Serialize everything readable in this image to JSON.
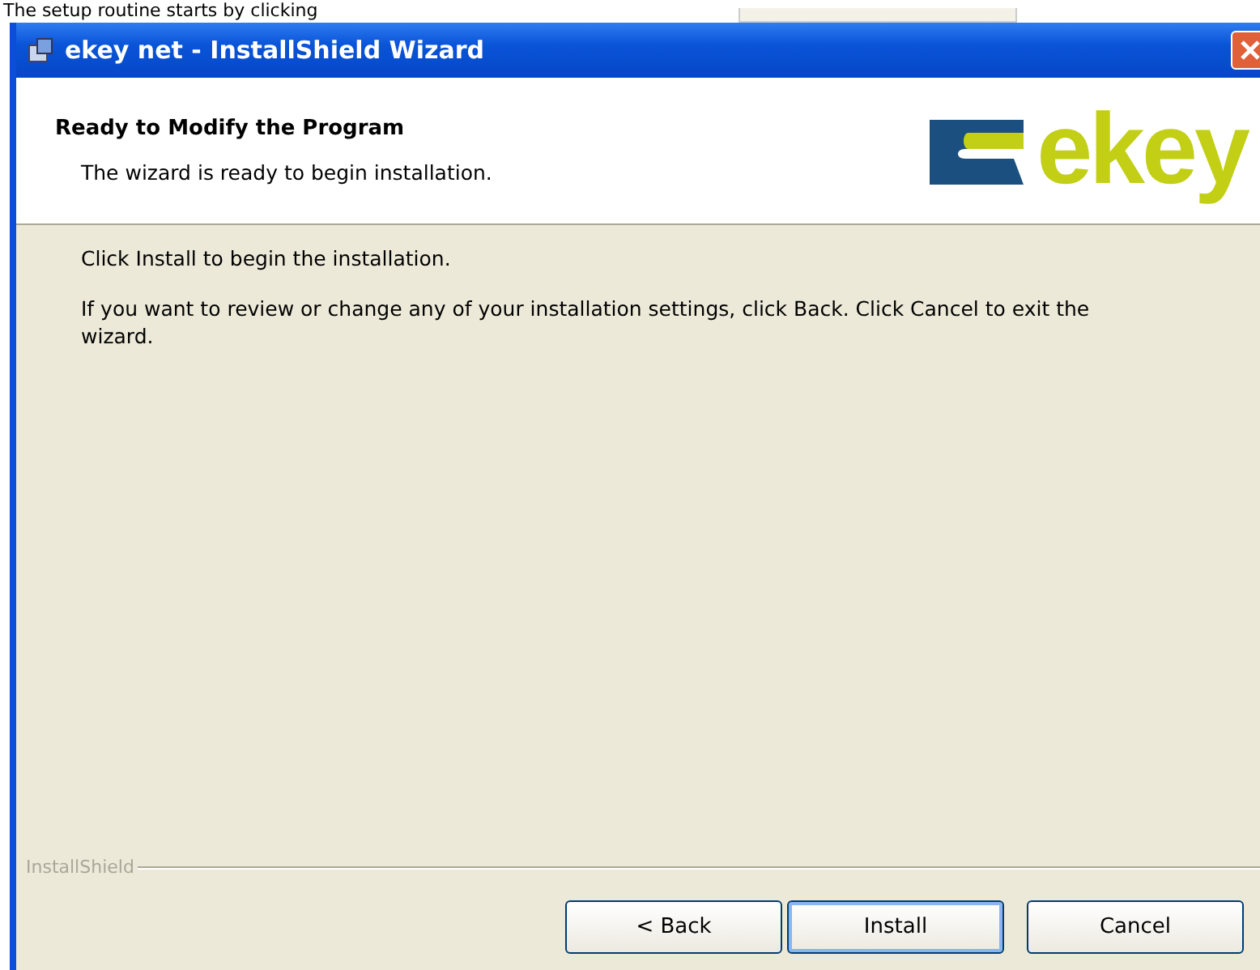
{
  "page_caption": "The setup routine starts by clicking",
  "window": {
    "title": "ekey net - InstallShield Wizard"
  },
  "header": {
    "title": "Ready to Modify the Program",
    "subtitle": "The wizard is ready to begin installation.",
    "logo_text": "ekey"
  },
  "body": [
    "Click Install to begin the installation.",
    "If you want to review or change any of your installation settings, click Back. Click Cancel to exit the wizard."
  ],
  "footer_brand": "InstallShield",
  "buttons": [
    {
      "label": "< Back",
      "default": false
    },
    {
      "label": "Install",
      "default": true
    },
    {
      "label": "Cancel",
      "default": false
    }
  ]
}
